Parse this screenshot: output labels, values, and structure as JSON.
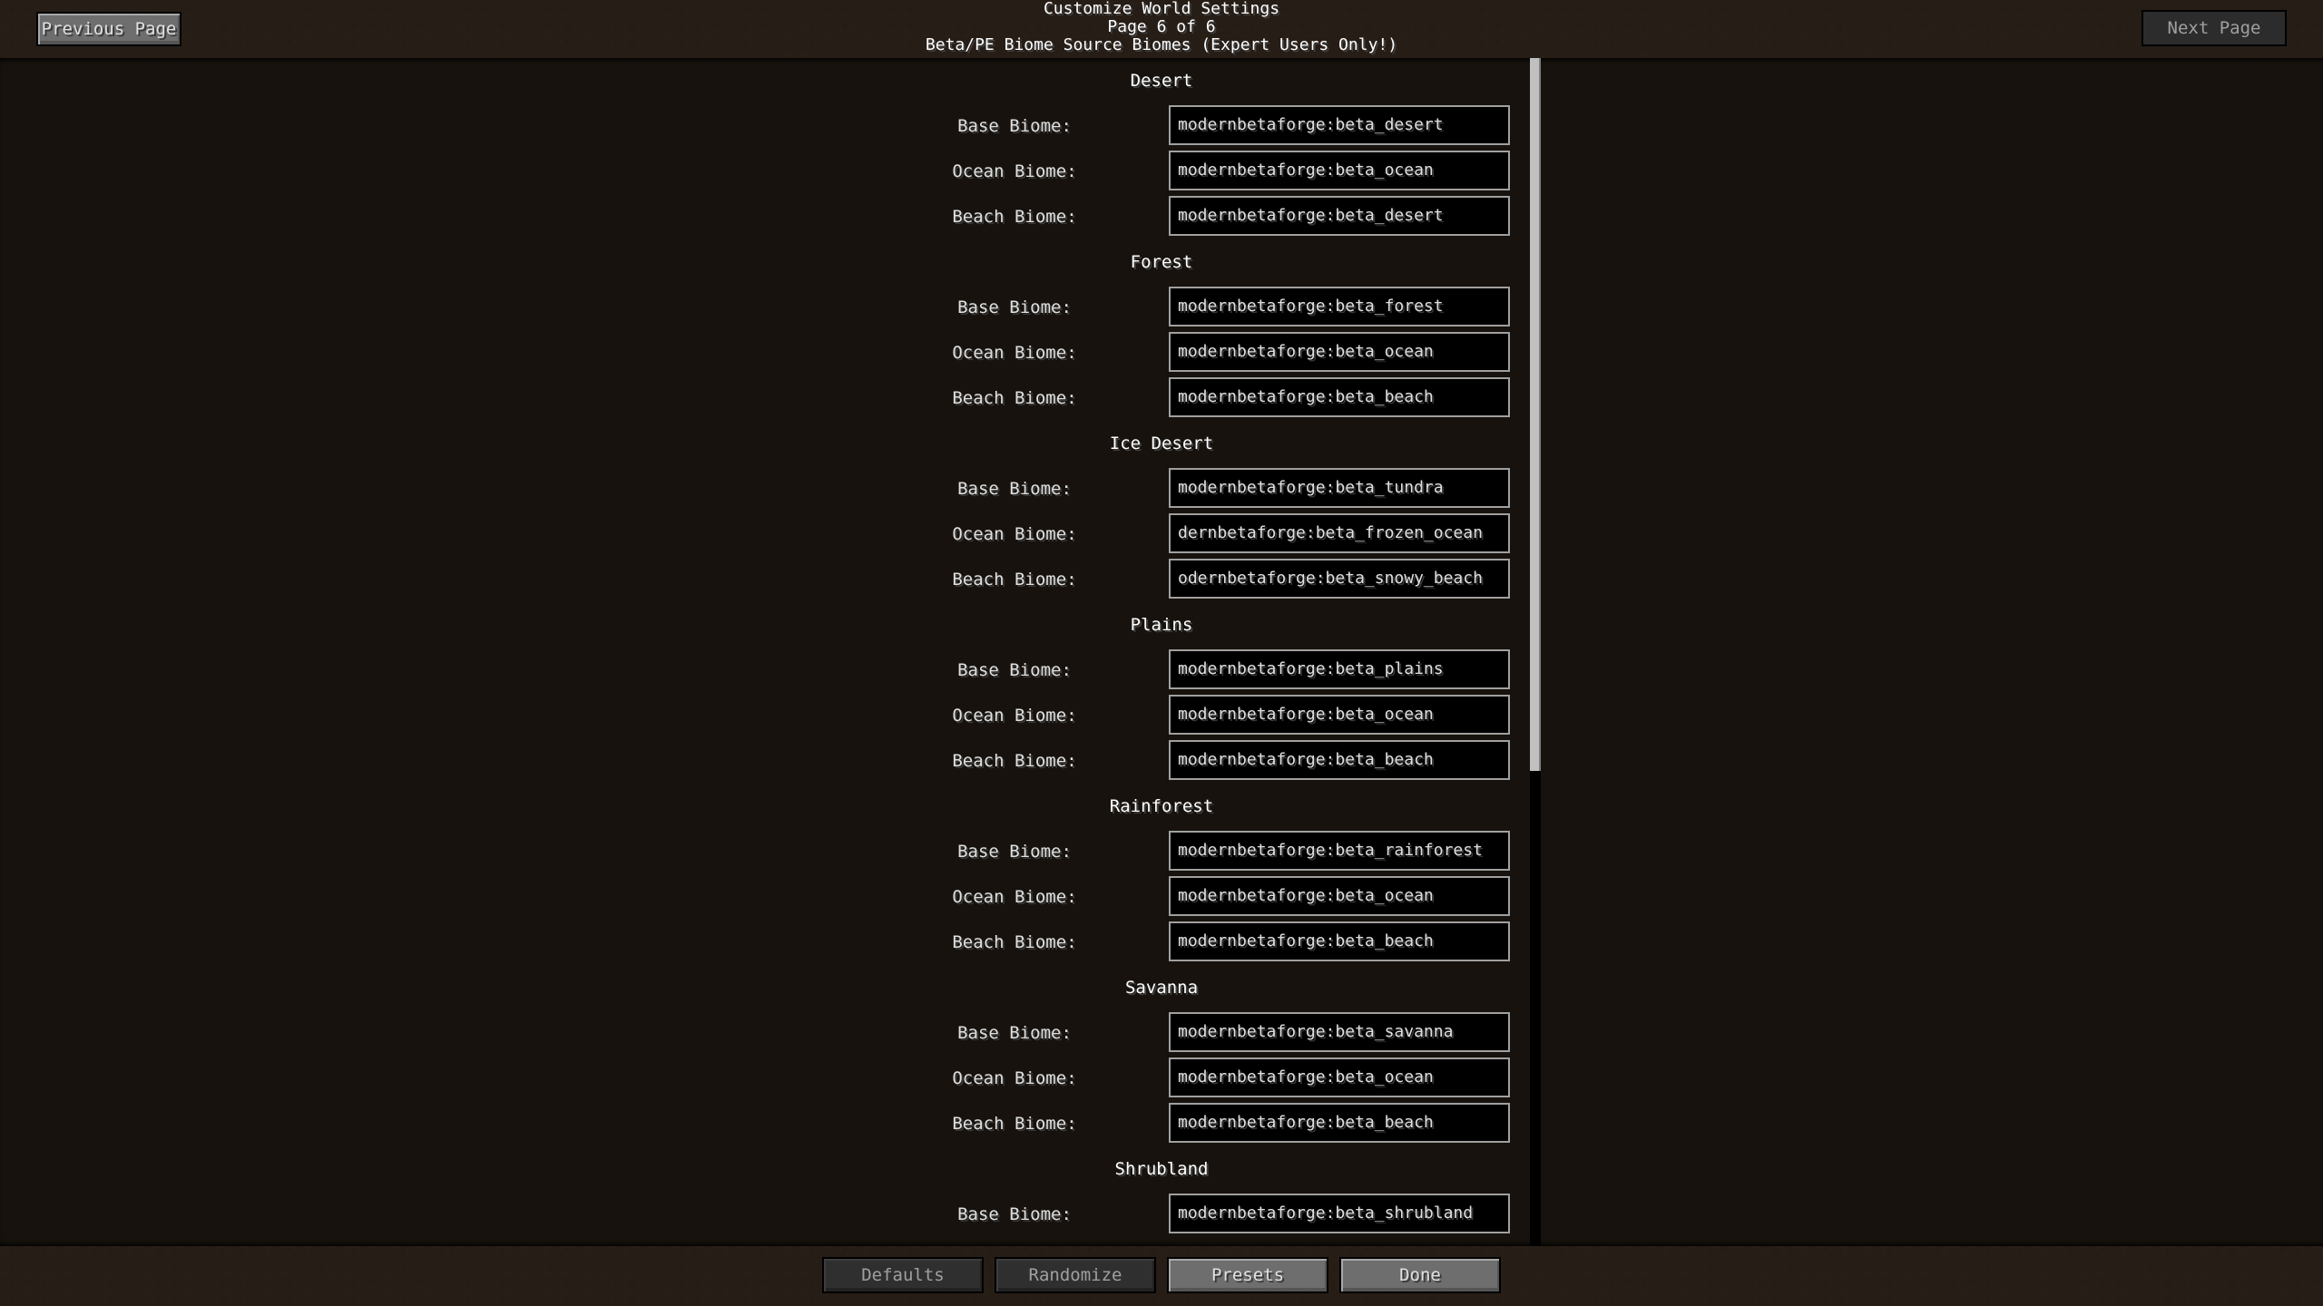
{
  "header": {
    "title": "Customize World Settings",
    "page_indicator": "Page 6 of 6",
    "subtitle": "Beta/PE Biome Source Biomes (Expert Users Only!)",
    "previous_page_label": "Previous Page",
    "next_page_label": "Next Page"
  },
  "sections": [
    {
      "title": "Desert",
      "fields": [
        {
          "label": "Base Biome:",
          "value": "modernbetaforge:beta_desert"
        },
        {
          "label": "Ocean Biome:",
          "value": "modernbetaforge:beta_ocean"
        },
        {
          "label": "Beach Biome:",
          "value": "modernbetaforge:beta_desert"
        }
      ]
    },
    {
      "title": "Forest",
      "fields": [
        {
          "label": "Base Biome:",
          "value": "modernbetaforge:beta_forest"
        },
        {
          "label": "Ocean Biome:",
          "value": "modernbetaforge:beta_ocean"
        },
        {
          "label": "Beach Biome:",
          "value": "modernbetaforge:beta_beach"
        }
      ]
    },
    {
      "title": "Ice Desert",
      "fields": [
        {
          "label": "Base Biome:",
          "value": "modernbetaforge:beta_tundra"
        },
        {
          "label": "Ocean Biome:",
          "value": "dernbetaforge:beta_frozen_ocean"
        },
        {
          "label": "Beach Biome:",
          "value": "odernbetaforge:beta_snowy_beach"
        }
      ]
    },
    {
      "title": "Plains",
      "fields": [
        {
          "label": "Base Biome:",
          "value": "modernbetaforge:beta_plains"
        },
        {
          "label": "Ocean Biome:",
          "value": "modernbetaforge:beta_ocean"
        },
        {
          "label": "Beach Biome:",
          "value": "modernbetaforge:beta_beach"
        }
      ]
    },
    {
      "title": "Rainforest",
      "fields": [
        {
          "label": "Base Biome:",
          "value": "modernbetaforge:beta_rainforest"
        },
        {
          "label": "Ocean Biome:",
          "value": "modernbetaforge:beta_ocean"
        },
        {
          "label": "Beach Biome:",
          "value": "modernbetaforge:beta_beach"
        }
      ]
    },
    {
      "title": "Savanna",
      "fields": [
        {
          "label": "Base Biome:",
          "value": "modernbetaforge:beta_savanna"
        },
        {
          "label": "Ocean Biome:",
          "value": "modernbetaforge:beta_ocean"
        },
        {
          "label": "Beach Biome:",
          "value": "modernbetaforge:beta_beach"
        }
      ]
    },
    {
      "title": "Shrubland",
      "fields": [
        {
          "label": "Base Biome:",
          "value": "modernbetaforge:beta_shrubland"
        }
      ]
    }
  ],
  "footer": {
    "defaults_label": "Defaults",
    "randomize_label": "Randomize",
    "presets_label": "Presets",
    "done_label": "Done"
  },
  "scrollbar": {
    "visible_fraction": 0.6,
    "scroll_position": 0.0
  }
}
